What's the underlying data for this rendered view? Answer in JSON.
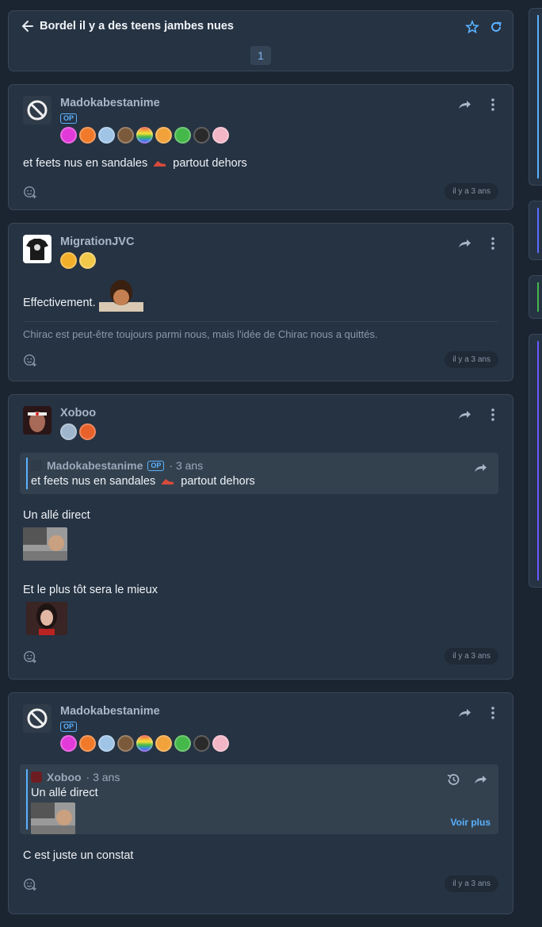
{
  "topic": {
    "title": "Bordel il y a des teens jambes nues",
    "page": "1",
    "icons": {
      "back": "arrow-left-icon",
      "favorite": "star-icon",
      "refresh": "refresh-icon"
    }
  },
  "posts": [
    {
      "author": "Madokabestanime",
      "op_label": "OP",
      "avatar": "banned-icon",
      "badge_colors": [
        "#e23ad8",
        "#f07a2a",
        "#9fc4e6",
        "#7a5a3a",
        "#e23a3a",
        "#f2a23a",
        "#45b84a",
        "#2a2a2a",
        "#f2b6c6"
      ],
      "text": "et feets nus en sandales",
      "text_after": "partout dehors",
      "emoji": "sandal-icon",
      "time": "il y a 3 ans"
    },
    {
      "author": "MigrationJVC",
      "avatar": "tshirt-avatar",
      "badge_colors": [
        "#f2b02a",
        "#f2c84a"
      ],
      "text": "Effectivement.",
      "signature": "Chirac est peut-être toujours parmi nous, mais l'idée de Chirac nous a quittés.",
      "time": "il y a 3 ans"
    },
    {
      "author": "Xoboo",
      "avatar": "headband-avatar",
      "badge_colors": [
        "#9fb6cc",
        "#e8612a"
      ],
      "quote": {
        "author": "Madokabestanime",
        "op_label": "OP",
        "age": "· 3 ans",
        "text": "et feets nus en sandales",
        "text_after": "partout dehors"
      },
      "lines": [
        "Un allé direct",
        "Et le plus tôt sera le mieux"
      ],
      "time": "il y a 3 ans"
    },
    {
      "author": "Madokabestanime",
      "op_label": "OP",
      "avatar": "banned-icon",
      "badge_colors": [
        "#e23ad8",
        "#f07a2a",
        "#9fc4e6",
        "#7a5a3a",
        "#e23a3a",
        "#f2a23a",
        "#45b84a",
        "#2a2a2a",
        "#f2b6c6"
      ],
      "quote": {
        "author": "Xoboo",
        "age": "· 3 ans",
        "text": "Un allé direct",
        "more": "Voir plus"
      },
      "text": "C est juste un constat",
      "time": "il y a 3 ans"
    }
  ],
  "colors": {
    "accent": "#5ab1ff",
    "card": "#263343",
    "background": "#1b2531"
  }
}
